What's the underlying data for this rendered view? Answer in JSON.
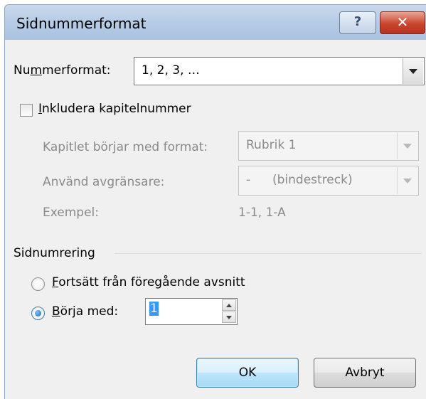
{
  "window": {
    "title": "Sidnummerformat",
    "help_label": "?",
    "close_label": "✕"
  },
  "number_format": {
    "label_pre": "Nu",
    "label_accel": "m",
    "label_post": "merformat:",
    "value": "1, 2, 3, …"
  },
  "include_chapter": {
    "label_accel": "I",
    "label_post": "nkludera kapitelnummer",
    "checked": false
  },
  "chapter": {
    "starts_label": "Kapitlet börjar med format:",
    "starts_value": "Rubrik 1",
    "separator_label": "Använd avgränsare:",
    "separator_dash": "-",
    "separator_name": "(bindestreck)",
    "example_label": "Exempel:",
    "example_value": "1-1, 1-A"
  },
  "page_numbering": {
    "group_label": "Sidnumrering",
    "continue_accel": "F",
    "continue_post": "ortsätt från föregående avsnitt",
    "start_accel": "B",
    "start_post": "örja med:",
    "start_value": "1",
    "selected": "start"
  },
  "buttons": {
    "ok": "OK",
    "cancel": "Avbryt"
  }
}
